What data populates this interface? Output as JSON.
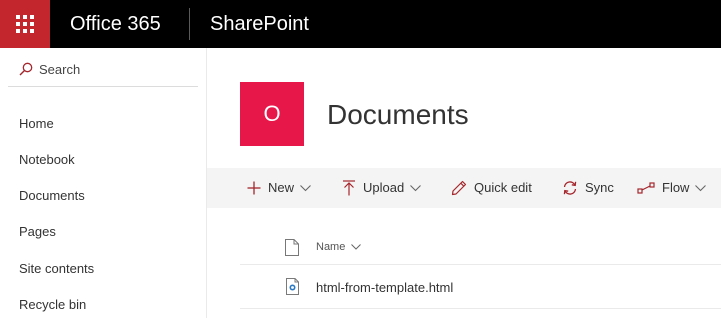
{
  "suite": {
    "brand": "Office 365",
    "app": "SharePoint",
    "waffle_color": "#c4262e"
  },
  "leftnav": {
    "search_label": "Search",
    "items": [
      {
        "label": "Home"
      },
      {
        "label": "Notebook"
      },
      {
        "label": "Documents"
      },
      {
        "label": "Pages"
      },
      {
        "label": "Site contents"
      },
      {
        "label": "Recycle bin"
      }
    ]
  },
  "site": {
    "logo_letter": "O",
    "logo_color": "#e8174a",
    "title": "Documents"
  },
  "commands": {
    "new": "New",
    "upload": "Upload",
    "quick_edit": "Quick edit",
    "sync": "Sync",
    "flow": "Flow",
    "accent_color": "#a4262c"
  },
  "list": {
    "column_name": "Name",
    "rows": [
      {
        "name": "html-from-template.html"
      }
    ]
  }
}
